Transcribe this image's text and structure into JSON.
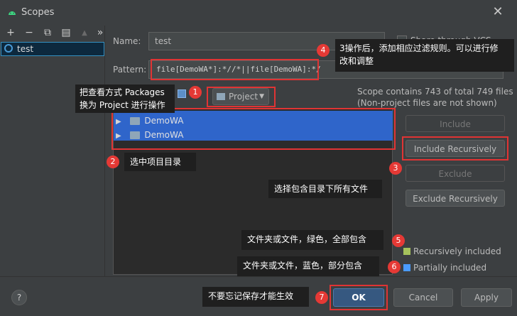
{
  "window": {
    "title": "Scopes",
    "close_label": "✕"
  },
  "toolbar": {
    "add": "+",
    "remove": "−",
    "copy": "⧉",
    "save": "▤",
    "up": "▲",
    "more": "»"
  },
  "scopes": [
    {
      "label": "test"
    }
  ],
  "form": {
    "name_label": "Name:",
    "name_value": "test",
    "share_label": "Share through VCS",
    "pattern_label": "Pattern:",
    "pattern_value": "file[DemoWA*]:*//*||file[DemoWA]:*/",
    "project_label": "Project",
    "scope_info_1": "Scope contains 743 of total 749 files",
    "scope_info_2": "(Non-project files are not shown)"
  },
  "tree": {
    "items": [
      {
        "label": "DemoWA"
      },
      {
        "label": "DemoWA"
      }
    ]
  },
  "buttons": {
    "include": "Include",
    "include_recursively": "Include Recursively",
    "exclude": "Exclude",
    "exclude_recursively": "Exclude Recursively",
    "ok": "OK",
    "cancel": "Cancel",
    "apply": "Apply",
    "help": "?"
  },
  "legend": {
    "recursive": {
      "label": "Recursively included",
      "color": "#a5c25c"
    },
    "partial": {
      "label": "Partially included",
      "color": "#4a9bff"
    }
  },
  "callouts": {
    "c1": {
      "num": "1",
      "line1": "把查看方式 Packages",
      "line2": "换为 Project 进行操作"
    },
    "c2": {
      "num": "2",
      "text": "选中项目目录"
    },
    "c3": {
      "num": "3",
      "text": "选择包含目录下所有文件"
    },
    "c4": {
      "num": "4",
      "line1": "3操作后，添加相应过滤规则。可以进行修",
      "line2": "改和调整"
    },
    "c5": {
      "num": "5",
      "text": "文件夹或文件，绿色，全部包含"
    },
    "c6": {
      "num": "6",
      "text": "文件夹或文件，蓝色，部分包含"
    },
    "c7": {
      "num": "7",
      "text": "不要忘记保存才能生效"
    }
  },
  "colors": {
    "accent": "#e53935",
    "selection": "#2f65ca"
  }
}
